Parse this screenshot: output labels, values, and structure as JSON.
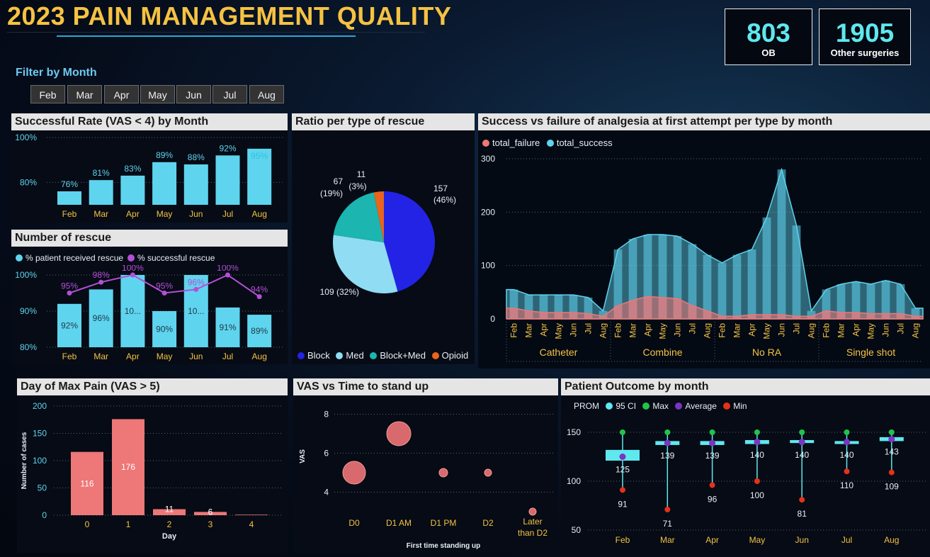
{
  "title": "2023 PAIN MANAGEMENT QUALITY",
  "kpis": [
    {
      "value": "803",
      "label": "OB"
    },
    {
      "value": "1905",
      "label": "Other surgeries"
    }
  ],
  "filter": {
    "label": "Filter by Month",
    "months": [
      "Feb",
      "Mar",
      "Apr",
      "May",
      "Jun",
      "Jul",
      "Aug"
    ]
  },
  "colors": {
    "bar_cyan": "#5fd4ee",
    "pink": "#ee7777",
    "purple": "#b44fd6",
    "block": "#2323e6",
    "med": "#8fdcf3",
    "block_med": "#1cb5b0",
    "opioid": "#e8651b",
    "gold": "#f5c242",
    "green": "#1fc44a",
    "red": "#e6301a",
    "violet": "#7a35c2"
  },
  "success_rate": {
    "title": "Successful Rate (VAS < 4) by Month",
    "chart_data": {
      "type": "bar",
      "categories": [
        "Feb",
        "Mar",
        "Apr",
        "May",
        "Jun",
        "Jul",
        "Aug"
      ],
      "values": [
        76,
        81,
        83,
        89,
        88,
        92,
        95
      ],
      "labels": [
        "76%",
        "81%",
        "83%",
        "89%",
        "88%",
        "92%",
        "95%"
      ],
      "ytick_labels": [
        "100%",
        "80%"
      ],
      "ylim": [
        70,
        100
      ]
    }
  },
  "rescue": {
    "title": "Number of rescue",
    "chart_data": {
      "type": "bar",
      "categories": [
        "Feb",
        "Mar",
        "Apr",
        "May",
        "Jun",
        "Jul",
        "Aug"
      ],
      "series": [
        {
          "name": "% patient received rescue",
          "values": [
            92,
            96,
            100,
            90,
            100,
            91,
            89
          ],
          "labels": [
            "92%",
            "96%",
            "10...",
            "90%",
            "10...",
            "91%",
            "89%"
          ]
        },
        {
          "name": "% successful rescue",
          "values": [
            95,
            98,
            100,
            95,
            96,
            100,
            94
          ],
          "labels": [
            "95%",
            "98%",
            "100%",
            "95%",
            "96%",
            "100%",
            "94%"
          ]
        }
      ],
      "ytick_labels": [
        "100%",
        "90%",
        "80%"
      ],
      "ylim": [
        80,
        100
      ]
    }
  },
  "ratio": {
    "title": "Ratio per type of rescue",
    "chart_data": {
      "type": "pie",
      "slices": [
        {
          "name": "Block",
          "value": 157,
          "label": "157",
          "pct": "(46%)"
        },
        {
          "name": "Med",
          "value": 109,
          "label": "109 (32%)",
          "pct": ""
        },
        {
          "name": "Block+Med",
          "value": 67,
          "label": "67",
          "pct": "(19%)"
        },
        {
          "name": "Opioid",
          "value": 11,
          "label": "11",
          "pct": "(3%)"
        }
      ]
    }
  },
  "analgesia": {
    "title": "Success vs failure of analgesia at first attempt per type by month",
    "legend": [
      "total_failure",
      "total_success"
    ],
    "chart_data": {
      "type": "area",
      "groups": [
        "Catheter",
        "Combine",
        "No RA",
        "Single shot"
      ],
      "months": [
        "Feb",
        "Mar",
        "Apr",
        "May",
        "Jun",
        "Jul",
        "Aug"
      ],
      "series": [
        {
          "name": "total_success",
          "values": [
            [
              55,
              45,
              45,
              45,
              45,
              40,
              15
            ],
            [
              130,
              150,
              158,
              158,
              155,
              140,
              120
            ],
            [
              105,
              120,
              130,
              190,
              280,
              175,
              15
            ],
            [
              55,
              65,
              70,
              65,
              72,
              65,
              20
            ]
          ]
        },
        {
          "name": "total_failure",
          "values": [
            [
              20,
              15,
              12,
              12,
              12,
              10,
              5
            ],
            [
              25,
              35,
              42,
              40,
              38,
              25,
              15
            ],
            [
              5,
              5,
              8,
              8,
              8,
              5,
              5
            ],
            [
              15,
              12,
              12,
              10,
              10,
              10,
              5
            ]
          ]
        }
      ],
      "yticks": [
        "300",
        "200",
        "100",
        "0"
      ],
      "ylim": [
        0,
        300
      ]
    }
  },
  "max_pain": {
    "title": "Day of Max Pain (VAS > 5)",
    "chart_data": {
      "type": "bar",
      "categories": [
        "0",
        "1",
        "2",
        "3",
        "4"
      ],
      "values": [
        116,
        176,
        11,
        6,
        1
      ],
      "labels": [
        "116",
        "176",
        "11",
        "6",
        ""
      ],
      "xlabel": "Day",
      "ylabel": "Number of cases",
      "yticks": [
        "200",
        "150",
        "100",
        "50",
        "0"
      ],
      "ylim": [
        0,
        200
      ]
    }
  },
  "vas_stand": {
    "title": "VAS vs Time to stand up",
    "chart_data": {
      "type": "scatter",
      "categories": [
        "D0",
        "D1 AM",
        "D1 PM",
        "D2",
        "Later than D2"
      ],
      "points": [
        {
          "x": "D0",
          "y": 5.0,
          "size": 16
        },
        {
          "x": "D1 AM",
          "y": 7.0,
          "size": 17
        },
        {
          "x": "D1 PM",
          "y": 5.0,
          "size": 6
        },
        {
          "x": "D2",
          "y": 5.0,
          "size": 5
        },
        {
          "x": "Later than D2",
          "y": 3.0,
          "size": 5
        }
      ],
      "xlabel": "First time standing up",
      "ylabel": "VAS",
      "yticks": [
        "8",
        "6",
        "4"
      ],
      "ylim": [
        2.6,
        8.6
      ]
    }
  },
  "outcome": {
    "title": "Patient Outcome by month",
    "legend_prefix": "PROM",
    "legend": [
      "95 CI",
      "Max",
      "Average",
      "Min"
    ],
    "chart_data": {
      "type": "scatter",
      "categories": [
        "Feb",
        "Mar",
        "Apr",
        "May",
        "Jun",
        "Jul",
        "Aug"
      ],
      "series": [
        {
          "name": "Max",
          "values": [
            150,
            150,
            150,
            150,
            150,
            150,
            150
          ]
        },
        {
          "name": "Average",
          "values": [
            125,
            139,
            139,
            140,
            140,
            140,
            143
          ],
          "labels": [
            "125",
            "139",
            "139",
            "140",
            "140",
            "140",
            "143"
          ]
        },
        {
          "name": "Min",
          "values": [
            91,
            71,
            96,
            100,
            81,
            110,
            109
          ],
          "labels": [
            "91",
            "71",
            "96",
            "100",
            "81",
            "110",
            "109"
          ]
        },
        {
          "name": "95 CI",
          "values": [
            [
              121,
              132
            ],
            [
              137,
              141
            ],
            [
              137,
              141
            ],
            [
              138,
              142
            ],
            [
              139,
              142
            ],
            [
              138,
              141
            ],
            [
              141,
              145
            ]
          ]
        }
      ],
      "yticks": [
        "150",
        "100",
        "50"
      ],
      "ylim": [
        50,
        155
      ]
    }
  }
}
